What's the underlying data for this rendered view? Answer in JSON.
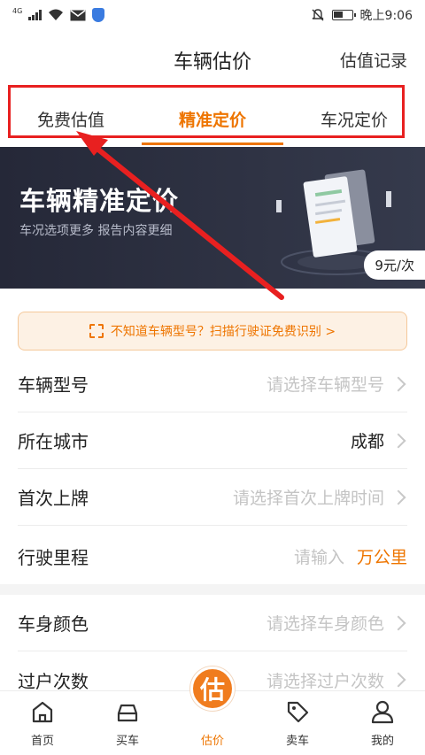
{
  "status_bar": {
    "network": "4G",
    "time": "晚上9:06"
  },
  "header": {
    "title": "车辆估价",
    "history_link": "估值记录"
  },
  "tabs": [
    {
      "label": "免费估值",
      "active": false
    },
    {
      "label": "精准定价",
      "active": true
    },
    {
      "label": "车况定价",
      "active": false
    }
  ],
  "banner": {
    "title": "车辆精准定价",
    "subtitle": "车况选项更多 报告内容更细",
    "price": "9元/次"
  },
  "scan_notice": {
    "text": "不知道车辆型号？扫描行驶证免费识别 >",
    "icon": "scan-icon"
  },
  "form": {
    "rows": [
      {
        "label": "车辆型号",
        "value": "请选择车辆型号"
      },
      {
        "label": "所在城市",
        "value": "成都"
      },
      {
        "label": "首次上牌",
        "value": "请选择首次上牌时间"
      },
      {
        "label": "行驶里程",
        "value": "请输入",
        "unit": "万公里"
      },
      {
        "label": "车身颜色",
        "value": "请选择车身颜色"
      },
      {
        "label": "过户次数",
        "value": "请选择过户次数"
      }
    ]
  },
  "bottom_nav": [
    {
      "label": "首页",
      "icon": "home-icon"
    },
    {
      "label": "买车",
      "icon": "car-icon"
    },
    {
      "label": "估价",
      "icon": "estimate-icon",
      "glyph": "估",
      "active": true
    },
    {
      "label": "卖车",
      "icon": "tag-icon"
    },
    {
      "label": "我的",
      "icon": "user-icon"
    }
  ],
  "colors": {
    "accent": "#ee7500",
    "highlight_box": "#e82020",
    "banner_bg": "#2a2d3d"
  }
}
